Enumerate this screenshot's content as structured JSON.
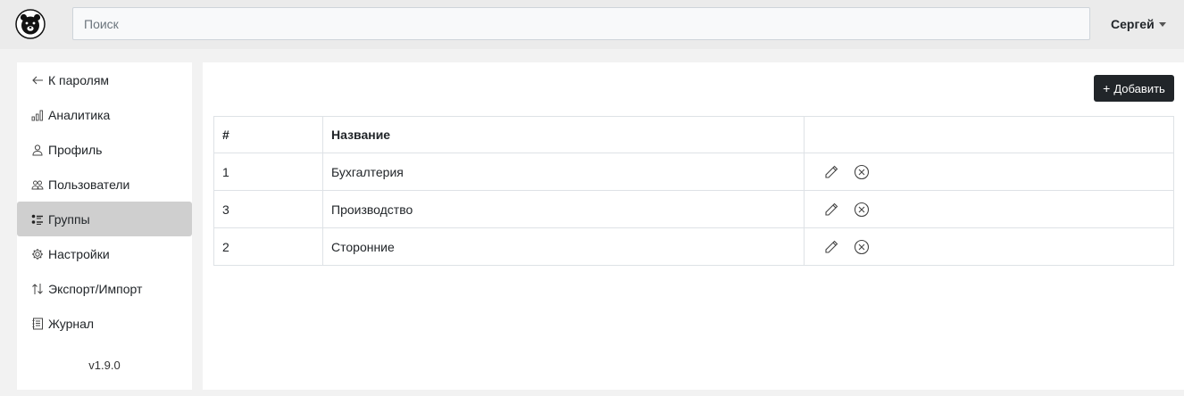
{
  "header": {
    "search_placeholder": "Поиск",
    "user_name": "Сергей"
  },
  "sidebar": {
    "items": [
      {
        "label": "К паролям",
        "icon": "arrow-left-icon",
        "name": "sidebar-item-back-to-passwords"
      },
      {
        "label": "Аналитика",
        "icon": "bar-chart-icon",
        "name": "sidebar-item-analytics"
      },
      {
        "label": "Профиль",
        "icon": "person-icon",
        "name": "sidebar-item-profile"
      },
      {
        "label": "Пользователи",
        "icon": "people-icon",
        "name": "sidebar-item-users"
      },
      {
        "label": "Группы",
        "icon": "list-icon",
        "name": "sidebar-item-groups",
        "active": true
      },
      {
        "label": "Настройки",
        "icon": "gear-icon",
        "name": "sidebar-item-settings"
      },
      {
        "label": "Экспорт/Импорт",
        "icon": "swap-vertical-icon",
        "name": "sidebar-item-export-import"
      },
      {
        "label": "Журнал",
        "icon": "journal-icon",
        "name": "sidebar-item-journal"
      }
    ],
    "version": "v1.9.0"
  },
  "main": {
    "add_button": {
      "plus": "+",
      "label": "Добавить"
    },
    "table": {
      "columns": [
        "#",
        "Название",
        ""
      ],
      "rows": [
        {
          "id": "1",
          "name": "Бухгалтерия"
        },
        {
          "id": "3",
          "name": "Производство"
        },
        {
          "id": "2",
          "name": "Сторонние"
        }
      ]
    }
  },
  "colors": {
    "accent": "#212529",
    "active_nav": "#cfcfcf",
    "background": "#f2f2f2"
  }
}
